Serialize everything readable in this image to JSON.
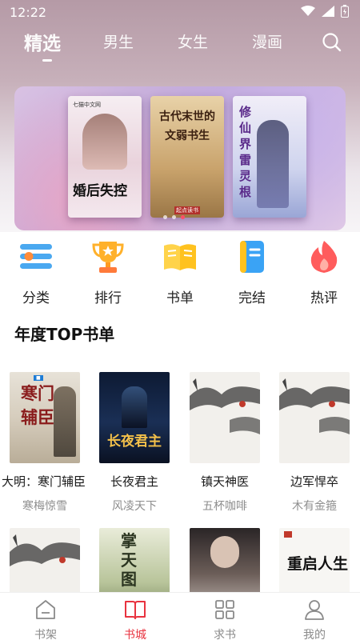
{
  "status": {
    "time": "12:22"
  },
  "top_tabs": [
    {
      "label": "精选",
      "active": true
    },
    {
      "label": "男生"
    },
    {
      "label": "女生"
    },
    {
      "label": "漫画"
    }
  ],
  "icons": {
    "search": "search-icon",
    "wifi": "wifi-icon",
    "signal": "signal-icon",
    "battery": "battery-icon"
  },
  "banner": {
    "books": [
      {
        "title": "婚后失控",
        "publisher": "七猫中文网"
      },
      {
        "title": "古代末世的文弱书生",
        "publisher": "起点读书"
      },
      {
        "title": "修仙界雷灵根",
        "publisher": ""
      }
    ],
    "active_dot": 2,
    "dot_count": 3
  },
  "categories": [
    {
      "label": "分类",
      "icon": "list-icon"
    },
    {
      "label": "排行",
      "icon": "trophy-icon"
    },
    {
      "label": "书单",
      "icon": "open-book-icon"
    },
    {
      "label": "完结",
      "icon": "finished-book-icon"
    },
    {
      "label": "热评",
      "icon": "flame-icon"
    }
  ],
  "section": {
    "title": "年度TOP书单"
  },
  "books_row1": [
    {
      "title": "大明：寒门辅臣",
      "author": "寒梅惊雪",
      "cover_text": "寒门辅臣"
    },
    {
      "title": "长夜君主",
      "author": "风凌天下",
      "cover_text": "长夜君主"
    },
    {
      "title": "镇天神医",
      "author": "五杯咖啡",
      "cover_text": ""
    },
    {
      "title": "边军悍卒",
      "author": "木有金箍",
      "cover_text": ""
    }
  ],
  "books_row2": [
    {
      "cover_text": ""
    },
    {
      "cover_text": "掌天图"
    },
    {
      "cover_text": ""
    },
    {
      "cover_text": "重启人生"
    }
  ],
  "bottom_nav": [
    {
      "label": "书架",
      "icon": "bookshelf-icon"
    },
    {
      "label": "书城",
      "icon": "bookstore-icon",
      "active": true
    },
    {
      "label": "求书",
      "icon": "grid-icon"
    },
    {
      "label": "我的",
      "icon": "profile-icon"
    }
  ],
  "colors": {
    "accent": "#e8323f",
    "header_tint": "#b59aa6",
    "muted": "#8d8d8d"
  }
}
